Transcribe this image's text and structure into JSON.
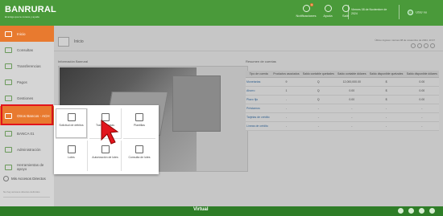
{
  "header": {
    "brand": "BANRURAL",
    "tagline": "El amigo que te conoce y ayuda",
    "notifications_label": "Notificaciones",
    "notifications_count": "0",
    "help_label": "Ayuda",
    "exit_label": "Salir",
    "datetime": "Viernes 08 de Noviembre de 2024",
    "user": "USU no"
  },
  "sidebar": {
    "items": [
      {
        "label": "Inicio"
      },
      {
        "label": "Consultas"
      },
      {
        "label": "Transferencias"
      },
      {
        "label": "Pagos"
      },
      {
        "label": "Gestiones"
      },
      {
        "label": "Otros Bancos - ACH"
      },
      {
        "label": "BANCA 01"
      },
      {
        "label": "Administración"
      },
      {
        "label": "Herramientas de apoyo"
      }
    ],
    "direct_access": "Mis Accesos Directos",
    "direct_access_sub": "No hay accesos directos definidos"
  },
  "main": {
    "breadcrumb": "Inicio",
    "last_login": "Último ingreso: viernes 08 de noviembre de 2024, 10:37",
    "info_title": "Información Banrural",
    "accounts_title": "Resumen de cuentas",
    "table": {
      "headers": [
        "Tipo de cuenta",
        "Productos asociados",
        "Saldo contable quetzales",
        "Saldo contable dólares",
        "Saldo disponible quetzales",
        "Saldo disponible dólares"
      ],
      "rows": [
        [
          "Monetarias",
          "9",
          "Q",
          "12,000,000.00",
          "$",
          "0.00"
        ],
        [
          "Ahorro",
          "1",
          "Q",
          "0.00",
          "$",
          "0.00"
        ],
        [
          "Plazo fijo",
          "-",
          "Q",
          "0.00",
          "$",
          "0.00"
        ],
        [
          "Préstamos",
          "-",
          "-",
          "-",
          "-",
          "-"
        ],
        [
          "Tarjetas de crédito",
          "-",
          "-",
          "-",
          "-",
          "-"
        ],
        [
          "Líneas de crédito",
          "-",
          "-",
          "-",
          "-",
          "-"
        ]
      ]
    }
  },
  "popup": {
    "items": [
      {
        "label": "Solicitud de débitos",
        "icon": "document-icon"
      },
      {
        "label": "Transferencias",
        "icon": "transfer-icon"
      },
      {
        "label": "Plantillas",
        "icon": "template-icon"
      },
      {
        "label": "Lotes",
        "icon": "batch-icon"
      },
      {
        "label": "Autorización de lotes",
        "icon": "authorize-icon"
      },
      {
        "label": "Consulta de lotes",
        "icon": "query-icon"
      }
    ]
  },
  "footer": {
    "brand": "Virtual"
  },
  "colors": {
    "primary_green": "#4a9a3a",
    "accent_orange": "#e87a2f",
    "highlight_red": "#e2141c"
  }
}
